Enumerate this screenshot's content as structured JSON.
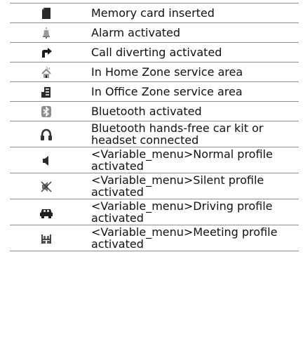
{
  "icon_status_table": {
    "rows": [
      {
        "icon": "memory-card-icon",
        "description": "Memory card inserted"
      },
      {
        "icon": "alarm-bell-icon",
        "description": "Alarm activated"
      },
      {
        "icon": "call-divert-arrow-icon",
        "description": "Call diverting activated"
      },
      {
        "icon": "home-zone-icon",
        "description": "In Home Zone service area"
      },
      {
        "icon": "office-zone-icon",
        "description": "In Office Zone service area"
      },
      {
        "icon": "bluetooth-icon",
        "description": "Bluetooth activated"
      },
      {
        "icon": "bluetooth-headset-icon",
        "description": "Bluetooth hands-free car kit or headset connected"
      },
      {
        "icon": "speaker-normal-icon",
        "description": "<Variable_menu>Normal profile activated"
      },
      {
        "icon": "speaker-muted-icon",
        "description": "<Variable_menu>Silent profile activated"
      },
      {
        "icon": "car-icon",
        "description": "<Variable_menu>Driving profile activated"
      },
      {
        "icon": "meeting-icon",
        "description": "<Variable_menu>Meeting profile activated"
      }
    ]
  }
}
